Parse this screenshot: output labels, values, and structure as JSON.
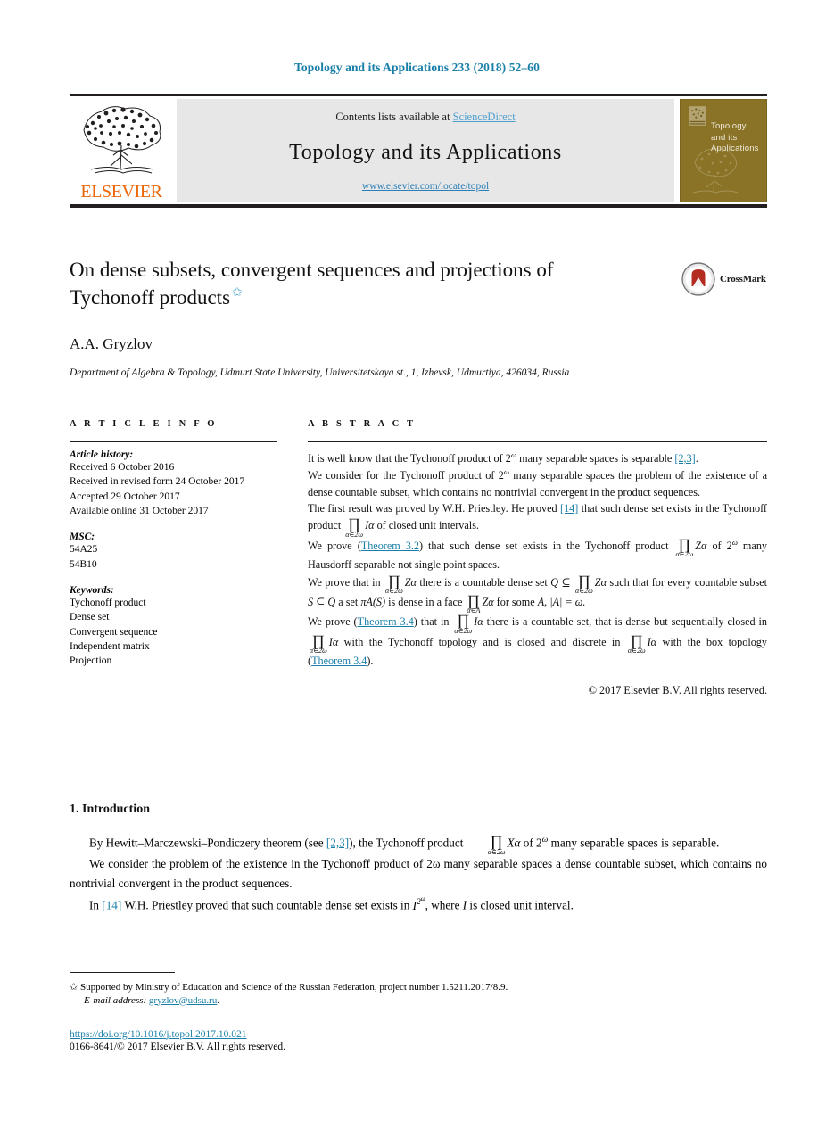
{
  "running_head": "Topology and its Applications 233 (2018) 52–60",
  "banner": {
    "contents_prefix": "Contents lists available at ",
    "sciencedirect": "ScienceDirect",
    "journal_title": "Topology and its Applications",
    "url": "www.elsevier.com/locate/topol",
    "publisher_wordmark": "ELSEVIER",
    "cover_title": "Topology and its Applications"
  },
  "article": {
    "title": "On dense subsets, convergent sequences and projections of Tychonoff products",
    "title_footnote_marker": "✩",
    "author": "A.A. Gryzlov",
    "affiliation": "Department of Algebra & Topology, Udmurt State University, Universitetskaya st., 1, Izhevsk, Udmurtiya, 426034, Russia",
    "crossmark_label": "CrossMark"
  },
  "info": {
    "heading": "A R T I C L E   I N F O",
    "history_label": "Article history:",
    "history": [
      "Received 6 October 2016",
      "Received in revised form 24 October 2017",
      "Accepted 29 October 2017",
      "Available online 31 October 2017"
    ],
    "msc_label": "MSC:",
    "msc": [
      "54A25",
      "54B10"
    ],
    "keywords_label": "Keywords:",
    "keywords": [
      "Tychonoff product",
      "Dense set",
      "Convergent sequence",
      "Independent matrix",
      "Projection"
    ]
  },
  "abstract": {
    "heading": "A B S T R A C T",
    "p1_a": "It is well know that the Tychonoff product of 2",
    "p1_b": " many separable spaces is separable ",
    "p1_ref": "[2,3]",
    "p1_c": ".",
    "p2_a": "We consider for the Tychonoff product of 2",
    "p2_b": " many separable spaces the problem of the existence of a dense countable subset, which contains no nontrivial convergent in the product sequences.",
    "p3_a": "The first result was proved by W.H. Priestley. He proved ",
    "p3_ref": "[14]",
    "p3_b": " that such dense set exists in the Tychonoff product ",
    "p3_c": " of closed unit intervals.",
    "p4_a": "We prove (",
    "p4_ref": "Theorem 3.2",
    "p4_b": ") that such dense set exists in the Tychonoff product ",
    "p4_c": " of 2",
    "p4_d": " many Hausdorff separable not single point spaces.",
    "p5_a": "We prove that in ",
    "p5_b": " there is a countable dense set ",
    "p5_c": " such that for every countable subset ",
    "p5_d": " a set ",
    "p5_e": " is dense in a face ",
    "p5_f": " for some ",
    "p5_g": ", ",
    "p6_a": "We prove (",
    "p6_ref": "Theorem 3.4",
    "p6_b": ") that in ",
    "p6_c": " there is a countable set, that is dense but sequentially closed in ",
    "p6_d": " with the Tychonoff topology and is closed and discrete in ",
    "p6_e": " with the box topology (",
    "p6_ref2": "Theorem 3.4",
    "p6_f": ").",
    "copyright": "© 2017 Elsevier B.V. All rights reserved."
  },
  "math": {
    "prod": "∏",
    "sub_alpha_2omega": "α∈2ω",
    "sub_alpha_A": "α∈A",
    "omega": "ω",
    "Z_alpha": "Zα",
    "I_alpha": "Iα",
    "X_alpha": "Xα",
    "Q": "Q",
    "S": "S",
    "A": "A",
    "subseteq": "⊆",
    "piA_S": "πA(S)",
    "absA": "|A| = ω."
  },
  "section": {
    "number_title": "1. Introduction",
    "para1_a": "By Hewitt–Marczewski–Pondiczery theorem (see ",
    "para1_ref": "[2,3]",
    "para1_b": "), the Tychonoff product ",
    "para1_c": " of 2",
    "para1_d": " many separable spaces is separable.",
    "para2": "We consider the problem of the existence in the Tychonoff product of 2ω many separable spaces a dense countable subset, which contains no nontrivial convergent in the product sequences.",
    "para3_a": "In ",
    "para3_ref": "[14]",
    "para3_b": " W.H. Priestley proved that such countable dense set exists in ",
    "para3_c": ", where ",
    "para3_d": " is closed unit interval."
  },
  "footer": {
    "star": "✩",
    "funding": "Supported by Ministry of Education and Science of the Russian Federation, project number 1.5211.2017/8.9.",
    "email_label": "E-mail address:",
    "email": "gryzlov@udsu.ru",
    "email_period": ".",
    "doi": "https://doi.org/10.1016/j.topol.2017.10.021",
    "issn": "0166-8641/© 2017 Elsevier B.V. All rights reserved."
  },
  "colors": {
    "link_blue": "#1a7fa8",
    "sciencedirect_blue": "#4ea0d0",
    "elsevier_orange": "#eb6608",
    "cover_olive": "#8a7326",
    "crossmark_red": "#c0392b"
  }
}
